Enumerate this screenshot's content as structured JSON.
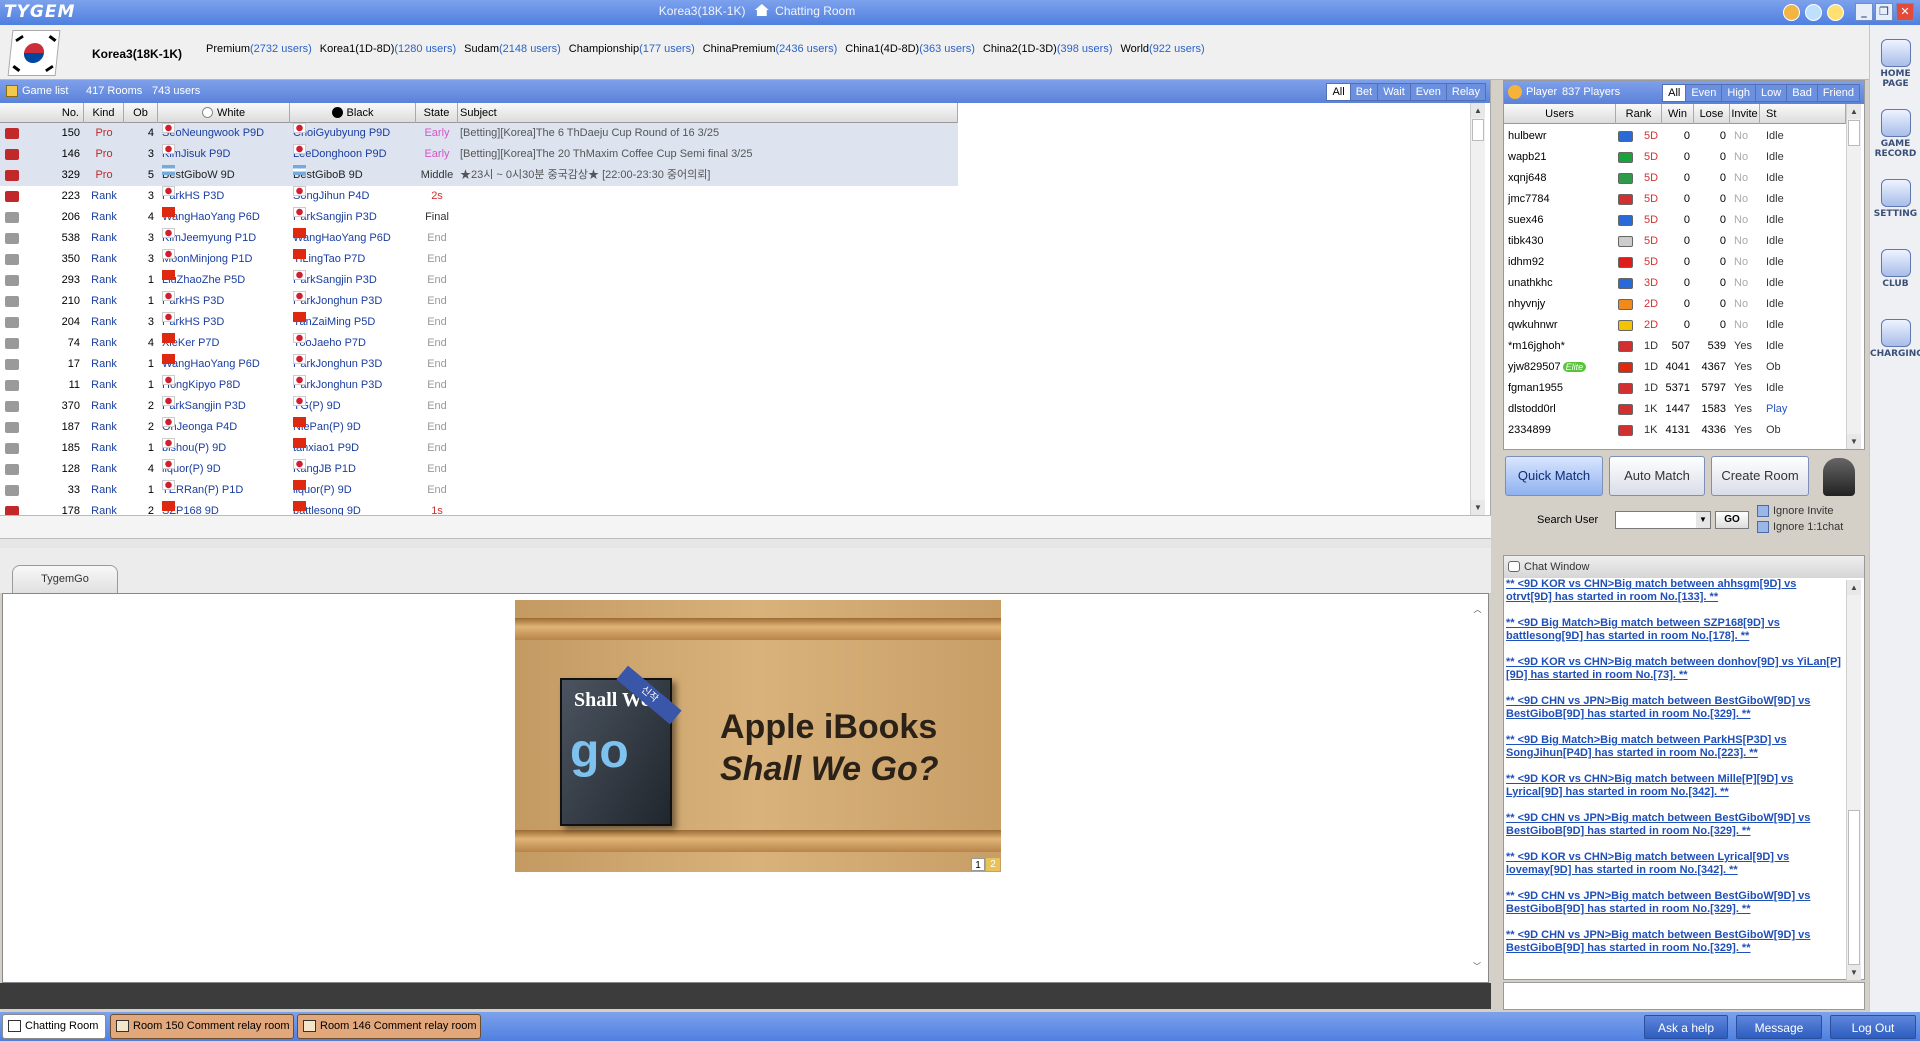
{
  "window": {
    "title": "Korea3(18K-1K)",
    "subtitle": "Chatting Room",
    "logo": "TYGEM"
  },
  "user": {
    "name": "Korea3(18K-1K)"
  },
  "servers": [
    {
      "name": "Premium",
      "count": "(2732 users)"
    },
    {
      "name": "Korea1(1D-8D)",
      "count": "(1280 users)"
    },
    {
      "name": "Sudam",
      "count": "(2148 users)"
    },
    {
      "name": "Championship",
      "count": "(177 users)"
    },
    {
      "name": "ChinaPremium",
      "count": "(2436 users)"
    },
    {
      "name": "China1(4D-8D)",
      "count": "(363 users)"
    },
    {
      "name": "China2(1D-3D)",
      "count": "(398 users)"
    },
    {
      "name": "World",
      "count": "(922 users)"
    }
  ],
  "dock": [
    "HOME PAGE",
    "GAME RECORD",
    "SETTING",
    "CLUB",
    "CHARGING"
  ],
  "gamelist": {
    "title": "Game list",
    "rooms": "417 Rooms",
    "users": "743 users",
    "tabs": [
      "All",
      "Bet",
      "Wait",
      "Even",
      "Relay"
    ],
    "headers": {
      "no": "No.",
      "kind": "Kind",
      "ob": "Ob",
      "white": "White",
      "black": "Black",
      "state": "State",
      "subject": "Subject"
    },
    "rows": [
      {
        "no": "150",
        "kind": "Pro",
        "ob": "4",
        "wf": "kr",
        "white": "SeoNeungwook P9D",
        "bf": "kr",
        "black": "ChoiGyubyung P9D",
        "state": "Early",
        "subject": "[Betting][Korea]The 6 ThDaeju Cup Round of 16 3/25",
        "hl": true
      },
      {
        "no": "146",
        "kind": "Pro",
        "ob": "3",
        "wf": "kr",
        "white": "KimJisuk P9D",
        "bf": "kr",
        "black": "LeeDonghoon P9D",
        "state": "Early",
        "subject": "[Betting][Korea]The 20 ThMaxim Coffee Cup Semi final 3/25",
        "hl": true
      },
      {
        "no": "329",
        "kind": "Pro",
        "ob": "5",
        "wf": "ar",
        "white": "BestGiboW 9D",
        "bf": "ar",
        "black": "BestGiboB 9D",
        "state": "Middle",
        "subject": "★23시 ~ 0시30분 중국감상★ [22:00-23:30 중어의뢰]",
        "hl": true
      },
      {
        "no": "223",
        "kind": "Rank",
        "ob": "3",
        "wf": "kr",
        "white": "ParkHS P3D",
        "bf": "kr",
        "black": "SongJihun P4D",
        "state": "2s"
      },
      {
        "no": "206",
        "kind": "Rank",
        "ob": "4",
        "wf": "cn",
        "white": "WangHaoYang P6D",
        "bf": "kr",
        "black": "ParkSangjin P3D",
        "state": "Final"
      },
      {
        "no": "538",
        "kind": "Rank",
        "ob": "3",
        "wf": "kr",
        "white": "KimJeemyung P1D",
        "bf": "cn",
        "black": "WangHaoYang P6D",
        "state": "End"
      },
      {
        "no": "350",
        "kind": "Rank",
        "ob": "3",
        "wf": "kr",
        "white": "MoonMinjong P1D",
        "bf": "cn",
        "black": "YiLingTao P7D",
        "state": "End"
      },
      {
        "no": "293",
        "kind": "Rank",
        "ob": "1",
        "wf": "cn",
        "white": "LiuZhaoZhe P5D",
        "bf": "kr",
        "black": "ParkSangjin P3D",
        "state": "End"
      },
      {
        "no": "210",
        "kind": "Rank",
        "ob": "1",
        "wf": "kr",
        "white": "ParkHS P3D",
        "bf": "kr",
        "black": "ParkJonghun P3D",
        "state": "End"
      },
      {
        "no": "204",
        "kind": "Rank",
        "ob": "3",
        "wf": "kr",
        "white": "ParkHS P3D",
        "bf": "cn",
        "black": "YanZaiMing P5D",
        "state": "End"
      },
      {
        "no": "74",
        "kind": "Rank",
        "ob": "4",
        "wf": "cn",
        "white": "XieKer P7D",
        "bf": "kr",
        "black": "YooJaeho P7D",
        "state": "End"
      },
      {
        "no": "17",
        "kind": "Rank",
        "ob": "1",
        "wf": "cn",
        "white": "WangHaoYang P6D",
        "bf": "kr",
        "black": "ParkJonghun P3D",
        "state": "End"
      },
      {
        "no": "11",
        "kind": "Rank",
        "ob": "1",
        "wf": "kr",
        "white": "HongKipyo P8D",
        "bf": "kr",
        "black": "ParkJonghun P3D",
        "state": "End"
      },
      {
        "no": "370",
        "kind": "Rank",
        "ob": "2",
        "wf": "kr",
        "white": "ParkSangjin P3D",
        "bf": "kr",
        "black": "YG(P) 9D",
        "state": "End"
      },
      {
        "no": "187",
        "kind": "Rank",
        "ob": "2",
        "wf": "kr",
        "white": "OhJeonga P4D",
        "bf": "cn",
        "black": "NiePan(P) 9D",
        "state": "End"
      },
      {
        "no": "185",
        "kind": "Rank",
        "ob": "1",
        "wf": "kr",
        "white": "bishou(P) 9D",
        "bf": "cn",
        "black": "tanxiao1 P9D",
        "state": "End"
      },
      {
        "no": "128",
        "kind": "Rank",
        "ob": "4",
        "wf": "kr",
        "white": "liquor(P) 9D",
        "bf": "kr",
        "black": "KangJB P1D",
        "state": "End"
      },
      {
        "no": "33",
        "kind": "Rank",
        "ob": "1",
        "wf": "kr",
        "white": "TERRan(P) P1D",
        "bf": "cn",
        "black": "liquor(P) 9D",
        "state": "End"
      },
      {
        "no": "178",
        "kind": "Rank",
        "ob": "2",
        "wf": "cn",
        "white": "SZP168 9D",
        "bf": "cn",
        "black": "battlesong 9D",
        "state": "1s"
      }
    ]
  },
  "browser_tab": "TygemGo",
  "banner": {
    "line1": "Apple iBooks",
    "line2": "Shall We Go?",
    "book_title": "Shall We",
    "book_word": "go",
    "ribbon": "신작",
    "pages": [
      "1",
      "2"
    ]
  },
  "players": {
    "title": "Player",
    "count": "837 Players",
    "tabs": [
      "All",
      "Even",
      "High",
      "Low",
      "Bad",
      "Friend"
    ],
    "headers": {
      "users": "Users",
      "rank": "Rank",
      "win": "Win",
      "lose": "Lose",
      "invite": "Invite",
      "st": "St"
    },
    "rows": [
      {
        "user": "hulbewr",
        "flag": "#2a6ad8",
        "rank": "5D",
        "win": "0",
        "lose": "0",
        "invite": "No",
        "st": "Idle"
      },
      {
        "user": "wapb21",
        "flag": "#1aa33b",
        "rank": "5D",
        "win": "0",
        "lose": "0",
        "invite": "No",
        "st": "Idle"
      },
      {
        "user": "xqnj648",
        "flag": "#2f9a4a",
        "rank": "5D",
        "win": "0",
        "lose": "0",
        "invite": "No",
        "st": "Idle"
      },
      {
        "user": "jmc7784",
        "flag": "#d23030",
        "rank": "5D",
        "win": "0",
        "lose": "0",
        "invite": "No",
        "st": "Idle"
      },
      {
        "user": "suex46",
        "flag": "#2a6ad8",
        "rank": "5D",
        "win": "0",
        "lose": "0",
        "invite": "No",
        "st": "Idle"
      },
      {
        "user": "tibk430",
        "flag": "#cccccc",
        "rank": "5D",
        "win": "0",
        "lose": "0",
        "invite": "No",
        "st": "Idle"
      },
      {
        "user": "idhm92",
        "flag": "#e01b1b",
        "rank": "5D",
        "win": "0",
        "lose": "0",
        "invite": "No",
        "st": "Idle"
      },
      {
        "user": "unathkhc",
        "flag": "#2a6ad8",
        "rank": "3D",
        "win": "0",
        "lose": "0",
        "invite": "No",
        "st": "Idle"
      },
      {
        "user": "nhyvnjy",
        "flag": "#f08a1a",
        "rank": "2D",
        "win": "0",
        "lose": "0",
        "invite": "No",
        "st": "Idle"
      },
      {
        "user": "qwkuhnwr",
        "flag": "#f5c400",
        "rank": "2D",
        "win": "0",
        "lose": "0",
        "invite": "No",
        "st": "Idle"
      },
      {
        "user": "*m16jghoh*",
        "flag": "#d23030",
        "rank": "1D",
        "win": "507",
        "lose": "539",
        "invite": "Yes",
        "st": "Idle"
      },
      {
        "user": "yjw829507",
        "badge": "Elite",
        "flag": "#de2910",
        "rank": "1D",
        "win": "4041",
        "lose": "4367",
        "invite": "Yes",
        "st": "Ob"
      },
      {
        "user": "fgman1955",
        "flag": "#d23030",
        "rank": "1D",
        "win": "5371",
        "lose": "5797",
        "invite": "Yes",
        "st": "Idle"
      },
      {
        "user": "dlstodd0rl",
        "flag": "#d23030",
        "rank": "1K",
        "win": "1447",
        "lose": "1583",
        "invite": "Yes",
        "st": "Play"
      },
      {
        "user": "2334899",
        "flag": "#d23030",
        "rank": "1K",
        "win": "4131",
        "lose": "4336",
        "invite": "Yes",
        "st": "Ob"
      }
    ]
  },
  "actions": {
    "quick": "Quick Match",
    "auto": "Auto Match",
    "create": "Create Room",
    "search_label": "Search User",
    "go": "GO",
    "ignore_invite": "Ignore Invite",
    "ignore_chat": "Ignore 1:1chat"
  },
  "chat": {
    "title": "Chat Window",
    "messages": [
      "** <9D KOR vs CHN>Big match between ahhsgm[9D] vs otrvt[9D] has started in room No.[133]. **",
      "** <9D Big Match>Big match between SZP168[9D] vs battlesong[9D] has started in room No.[178]. **",
      "** <9D KOR vs CHN>Big match between donhov[9D] vs YiLan[P][9D] has started in room No.[73]. **",
      "** <9D CHN vs JPN>Big match between BestGiboW[9D] vs BestGiboB[9D] has started in room No.[329]. **",
      "** <9D Big Match>Big match between ParkHS[P3D] vs SongJihun[P4D] has started in room No.[223]. **",
      "** <9D KOR vs CHN>Big match between Mille[P][9D] vs Lyrical[9D] has started in room No.[342]. **",
      "** <9D CHN vs JPN>Big match between BestGiboW[9D] vs BestGiboB[9D] has started in room No.[329]. **",
      "** <9D KOR vs CHN>Big match between Lyrical[9D] vs lovemay[9D] has started in room No.[342]. **",
      "** <9D CHN vs JPN>Big match between BestGiboW[9D] vs BestGiboB[9D] has started in room No.[329]. **",
      "** <9D CHN vs JPN>Big match between BestGiboW[9D] vs BestGiboB[9D] has started in room No.[329]. **"
    ]
  },
  "bottom": {
    "tabs": [
      "Chatting Room",
      "Room 150 Comment relay room",
      "Room 146 Comment relay room"
    ],
    "buttons": [
      "Ask a help",
      "Message",
      "Log Out"
    ]
  }
}
